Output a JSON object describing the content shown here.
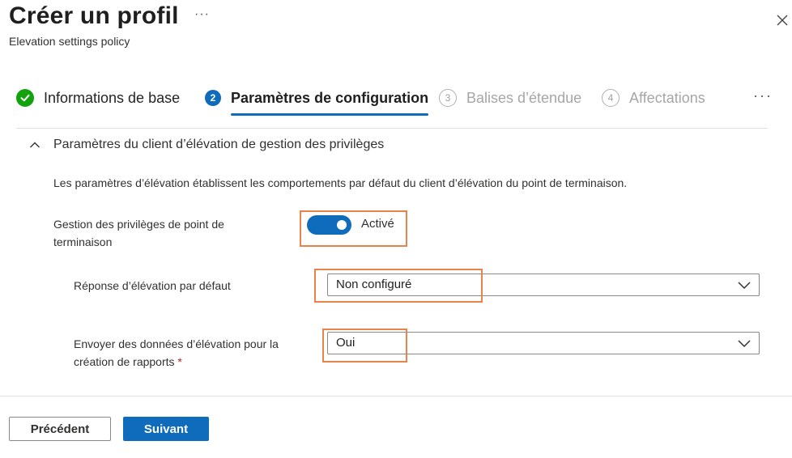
{
  "header": {
    "title": "Créer un profil",
    "more": "···",
    "subtitle": "Elevation settings policy"
  },
  "tabs": [
    {
      "label": "Informations de base",
      "state": "completed",
      "icon": "check-icon"
    },
    {
      "number": "2",
      "label": "Paramètres de configuration",
      "state": "active"
    },
    {
      "number": "3",
      "label": "Balises d’étendue",
      "state": "disabled"
    },
    {
      "number": "4",
      "label": "Affectations",
      "state": "disabled"
    }
  ],
  "tabs_more": "···",
  "section": {
    "title": "Paramètres du client d’élévation de gestion des privilèges",
    "description": "Les paramètres d’élévation établissent les comportements par défaut du client d’élévation du point de terminaison."
  },
  "fields": {
    "toggle": {
      "label": "Gestion des privilèges de point de terminaison",
      "state_label": "Activé",
      "on": true
    },
    "response": {
      "label": "Réponse d’élévation par défaut",
      "value": "Non configuré"
    },
    "send": {
      "label": "Envoyer des données d’élévation pour la création de rapports",
      "required_mark": "*",
      "value": "Oui"
    }
  },
  "footer": {
    "prev_label": "Précédent",
    "next_label": "Suivant"
  },
  "colors": {
    "accent": "#0f6cbd",
    "success": "#13a10e",
    "highlight": "#e8834a"
  }
}
